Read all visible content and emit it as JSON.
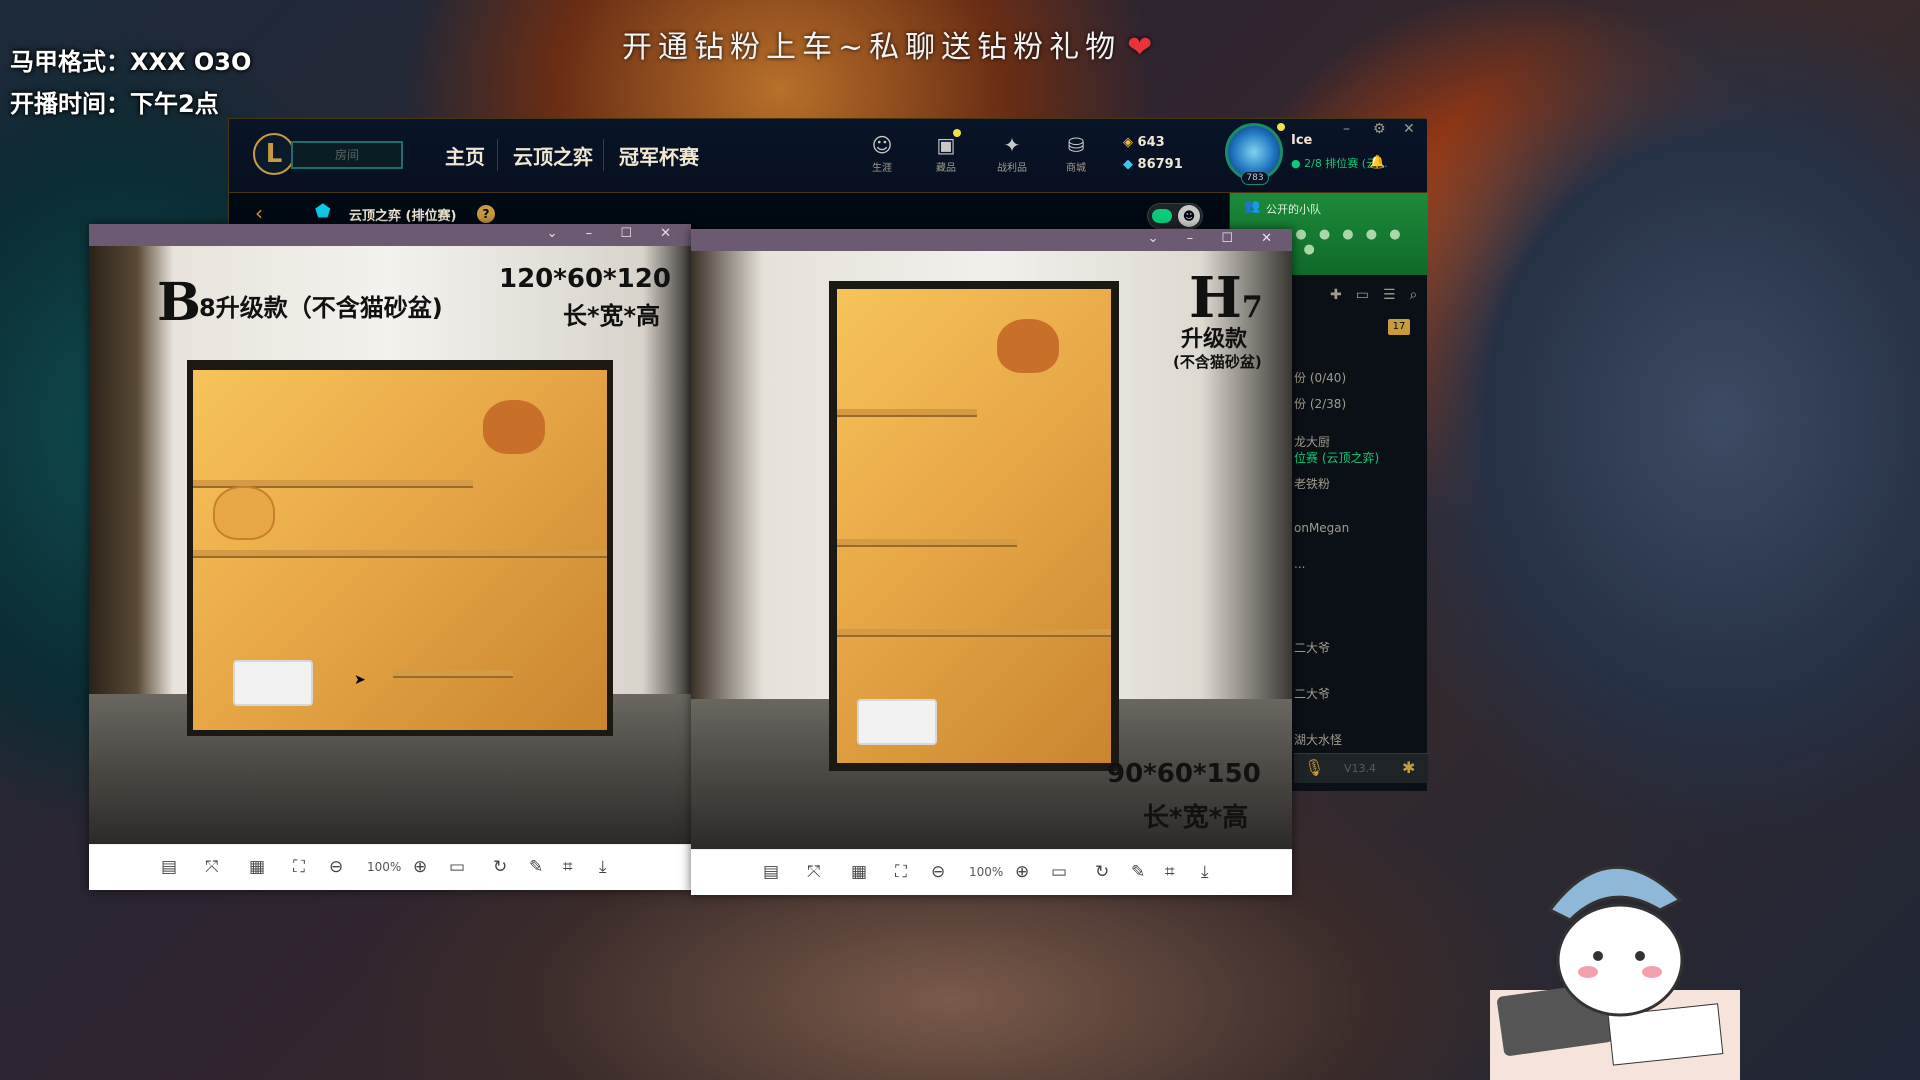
{
  "overlay": {
    "line1": "马甲格式：XXX O3O",
    "line2": "开播时间：下午2点",
    "banner": "开通钻粉上车~私聊送钻粉礼物",
    "heart": "❤"
  },
  "client": {
    "logo": "L",
    "play_button": "房间",
    "nav": [
      "主页",
      "云顶之弈",
      "冠军杯赛"
    ],
    "top_icons": [
      {
        "icon": "profile-icon",
        "glyph": "☺",
        "label": "生涯"
      },
      {
        "icon": "collection-icon",
        "glyph": "▣",
        "label": "藏品"
      },
      {
        "icon": "loot-icon",
        "glyph": "✦",
        "label": "战利品"
      },
      {
        "icon": "store-icon",
        "glyph": "⛁",
        "label": "商城"
      }
    ],
    "currency": {
      "rp": "643",
      "be": "86791"
    },
    "user": {
      "name": "Ice",
      "level": "783",
      "status": "2/8 排位赛 (云..."
    },
    "window_controls": [
      "–",
      "⚙",
      "✕"
    ],
    "subbar": {
      "back": "‹",
      "mode": "云顶之弈 (排位赛)",
      "help": "?"
    },
    "social": {
      "party_label": "公开的小队",
      "party_dots": "●● ● ● ● ● ● ●",
      "badge": "17",
      "friends": [
        {
          "text": "份 (0/40)",
          "green": false
        },
        {
          "text": "份 (2/38)",
          "green": false
        },
        {
          "text": "龙大厨",
          "green": false
        },
        {
          "text": "位赛 (云顶之弈)",
          "green": true
        },
        {
          "text": "老铁粉",
          "green": false
        },
        {
          "text": "onMegan",
          "green": false
        },
        {
          "text": "...",
          "green": false
        },
        {
          "text": "二大爷",
          "green": false
        },
        {
          "text": "二大爷",
          "green": false
        },
        {
          "text": "湖大水怪",
          "green": false
        }
      ],
      "version": "V13.4"
    }
  },
  "viewer1": {
    "window_controls": "⌄ – ☐ ✕",
    "label_big": "B",
    "label_rest": "8升级款（不含猫砂盆)",
    "dims": "120*60*120",
    "dims_label": "长*宽*高",
    "zoom": "100%"
  },
  "viewer2": {
    "window_controls": "⌄ – ☐ ✕",
    "label_big": "H",
    "label_num": "7",
    "label_sub": "升级款",
    "label_sub2": "(不含猫砂盆)",
    "dims": "90*60*150",
    "dims_label": "长*宽*高",
    "zoom": "100%"
  },
  "toolbar_icons": [
    {
      "icon": "layout-icon",
      "glyph": "▤"
    },
    {
      "icon": "fit-icon",
      "glyph": "⤧"
    },
    {
      "icon": "gallery-icon",
      "glyph": "▦"
    },
    {
      "icon": "fullscreen-icon",
      "glyph": "⛶"
    },
    {
      "icon": "zoom-out-icon",
      "glyph": "⊖"
    },
    {
      "icon": "zoom-in-icon",
      "glyph": "⊕"
    },
    {
      "icon": "actual-size-icon",
      "glyph": "▭"
    },
    {
      "icon": "rotate-icon",
      "glyph": "↻"
    },
    {
      "icon": "edit-icon",
      "glyph": "✎"
    },
    {
      "icon": "crop-icon",
      "glyph": "⌗"
    },
    {
      "icon": "download-icon",
      "glyph": "⤓"
    }
  ]
}
